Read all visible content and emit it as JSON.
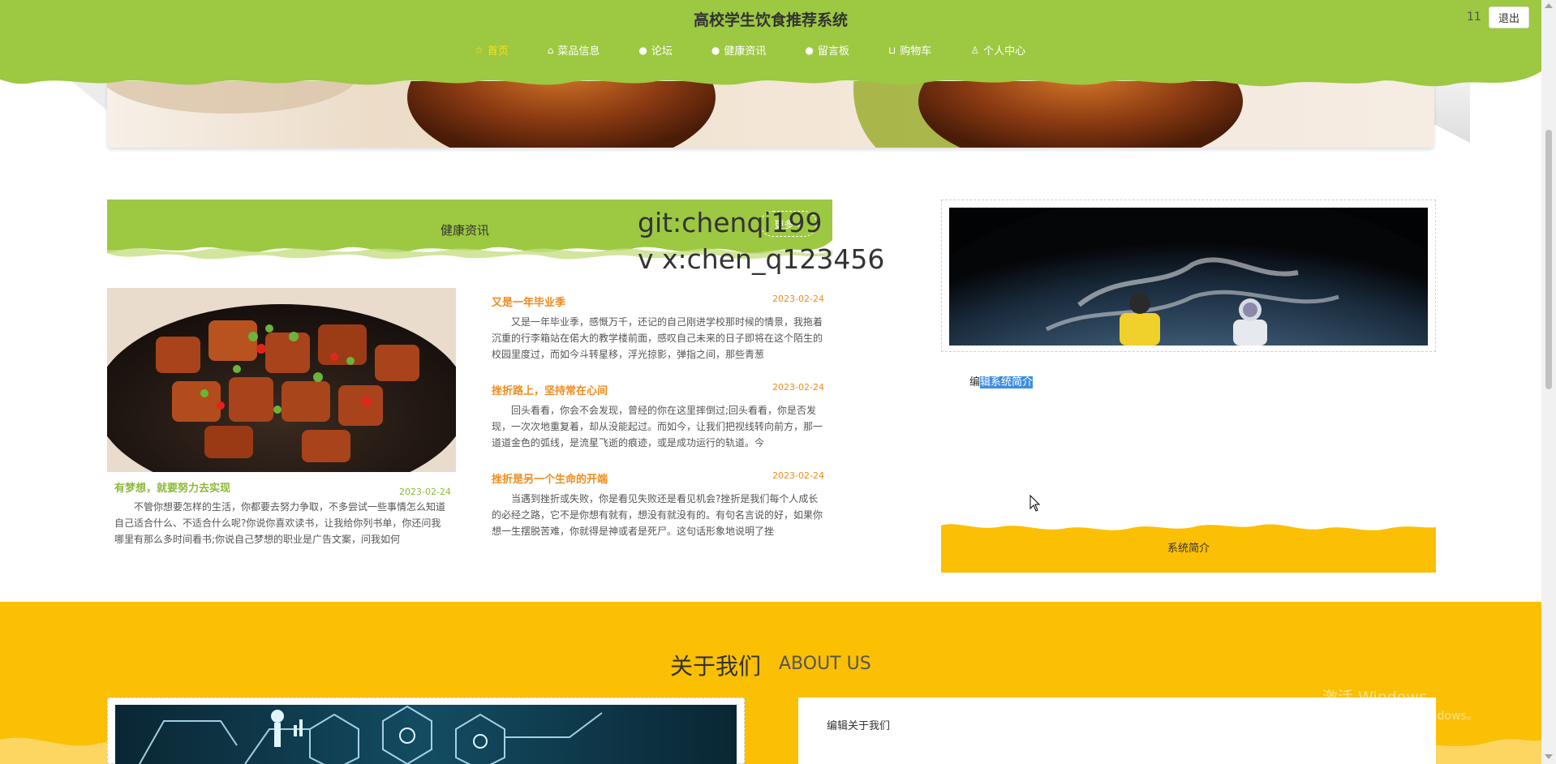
{
  "header": {
    "title": "高校学生饮食推荐系统",
    "user": "11",
    "logout_label": "退出",
    "nav": [
      {
        "label": "首页",
        "icon": "star-icon",
        "active": true
      },
      {
        "label": "菜品信息",
        "icon": "bag-icon"
      },
      {
        "label": "论坛",
        "icon": "info-icon"
      },
      {
        "label": "健康资讯",
        "icon": "info-icon"
      },
      {
        "label": "留言板",
        "icon": "info-icon"
      },
      {
        "label": "购物车",
        "icon": "cart-icon"
      },
      {
        "label": "个人中心",
        "icon": "user-icon"
      }
    ]
  },
  "news": {
    "section_title": "健康资讯",
    "more_label": "更多 »",
    "featured": {
      "title": "有梦想，就要努力去实现",
      "date": "2023-02-24",
      "summary": "不管你想要怎样的生活，你都要去努力争取，不多尝试一些事情怎么知道自己适合什么、不适合什么呢?你说你喜欢读书，让我给你列书单，你还问我哪里有那么多时间看书;你说自己梦想的职业是广告文案，问我如何"
    },
    "items": [
      {
        "title": "又是一年毕业季",
        "date": "2023-02-24",
        "summary": "又是一年毕业季，感慨万千，还记的自己刚进学校那时候的情景，我拖着沉重的行李箱站在偌大的教学楼前面，感叹自己未来的日子即将在这个陌生的校园里度过，而如今斗转星移，浮光掠影，弹指之间，那些青葱"
      },
      {
        "title": "挫折路上，坚持常在心间",
        "date": "2023-02-24",
        "summary": "回头看看，你会不会发现，曾经的你在这里摔倒过;回头看看，你是否发现，一次次地重复着，却从没能起过。而如今，让我们把视线转向前方，那一道道金色的弧线，是流星飞逝的痕迹，或是成功运行的轨道。今"
      },
      {
        "title": "挫折是另一个生命的开端",
        "date": "2023-02-24",
        "summary": "当遇到挫折或失败，你是看见失败还是看见机会?挫折是我们每个人成长的必经之路，它不是你想有就有，想没有就没有的。有句名言说的好，如果你想一生摆脱苦难，你就得是神或者是死尸。这句话形象地说明了挫"
      }
    ]
  },
  "watermark": {
    "git": "git:chenqi199",
    "vx": "v x:chen_q123456"
  },
  "intro": {
    "text_prefix": "编",
    "text_selected": "辑系统简介",
    "footer_label": "系统简介"
  },
  "about": {
    "title": "关于我们",
    "title_en": "ABOUT US",
    "text": "编辑关于我们"
  },
  "os_overlay": {
    "line1": "激活 Windows",
    "line2": "转到\"设置\"以激活 Windows。"
  },
  "colors": {
    "header_green": "#9dc841",
    "news_green": "#9dc841",
    "accent_orange": "#f18b1c",
    "about_yellow": "#fbbf04",
    "nav_active": "#f9e11a"
  }
}
